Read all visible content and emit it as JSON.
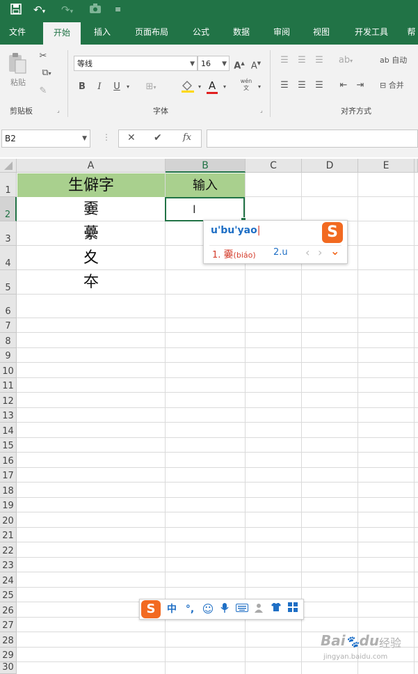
{
  "qat": {
    "save_icon": "save-icon",
    "undo_icon": "undo-icon",
    "redo_icon": "redo-icon",
    "camera_icon": "camera-icon",
    "customize_icon": "customize-icon"
  },
  "tabs": [
    "文件",
    "开始",
    "插入",
    "页面布局",
    "公式",
    "数据",
    "审阅",
    "视图",
    "开发工具",
    "帮"
  ],
  "ribbon": {
    "clipboard": {
      "paste_label": "粘贴",
      "group_label": "剪贴板"
    },
    "font": {
      "font_name": "等线",
      "font_size": "16",
      "bold": "B",
      "italic": "I",
      "underline": "U",
      "grow": "A",
      "shrink": "A",
      "font_color_letter": "A",
      "phonetic": "wén",
      "group_label": "字体"
    },
    "alignment": {
      "wrap_label": "自动",
      "merge_label": "合并",
      "group_label": "对齐方式"
    }
  },
  "formula_bar": {
    "name_box": "B2",
    "cancel": "✕",
    "enter": "✔",
    "fx": "fx",
    "formula": ""
  },
  "columns": [
    "A",
    "B",
    "C",
    "D",
    "E"
  ],
  "rows": [
    "1",
    "2",
    "3",
    "4",
    "5",
    "6",
    "7",
    "8",
    "9",
    "10",
    "11",
    "12",
    "13",
    "14",
    "15",
    "16",
    "17",
    "18",
    "19",
    "20",
    "21",
    "22",
    "23",
    "24",
    "25",
    "26",
    "27",
    "28",
    "29",
    "30"
  ],
  "cells": {
    "A1": "生僻字",
    "B1": "输入",
    "A2": "嫑",
    "A3": "虆",
    "A4": "夊",
    "A5": "夲"
  },
  "ime": {
    "input": "u'bu'yao",
    "cand1_num": "1.",
    "cand1_char": "嫑",
    "cand1_pinyin": "(biáo)",
    "cand2": "2.u",
    "nav_prev": "‹",
    "nav_next": "›",
    "expand": "⌄",
    "logo": "S"
  },
  "ime_bar": {
    "logo": "S",
    "mode": "中",
    "punct": "°,",
    "emoji_icon": "smile-icon",
    "voice_icon": "mic-icon",
    "keyboard_icon": "keyboard-icon",
    "user_icon": "user-icon",
    "skin_icon": "shirt-icon",
    "tools_icon": "grid-icon"
  },
  "watermark": {
    "brand": "Bai",
    "brand2": "du",
    "jingyan": "经验",
    "url": "jingyan.baidu.com"
  },
  "colors": {
    "excel_green": "#217346",
    "header_fill": "#a9d08e",
    "ime_orange": "#f26a21",
    "ime_blue": "#1f6fc5",
    "candidate_red": "#d43c2b"
  }
}
